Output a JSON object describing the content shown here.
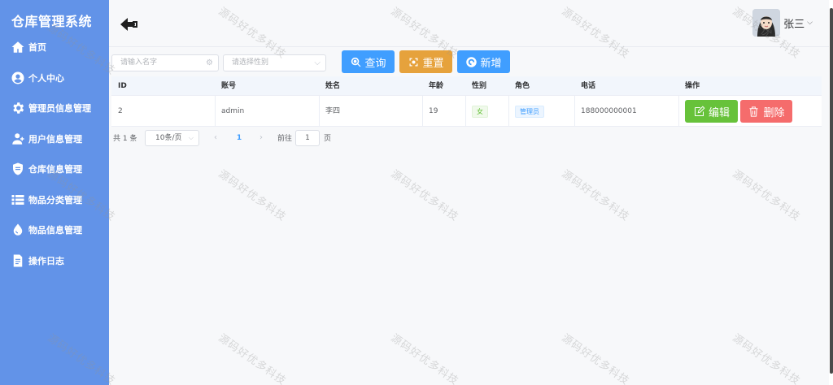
{
  "app": {
    "title": "仓库管理系统"
  },
  "sidebar": {
    "items": [
      {
        "label": "首页",
        "icon": "home-icon"
      },
      {
        "label": "个人中心",
        "icon": "user-center-icon"
      },
      {
        "label": "管理员信息管理",
        "icon": "gear-icon"
      },
      {
        "label": "用户信息管理",
        "icon": "user-add-icon"
      },
      {
        "label": "仓库信息管理",
        "icon": "shield-icon"
      },
      {
        "label": "物品分类管理",
        "icon": "list-icon"
      },
      {
        "label": "物品信息管理",
        "icon": "drop-icon"
      },
      {
        "label": "操作日志",
        "icon": "document-icon"
      }
    ]
  },
  "header": {
    "user_name": "张三",
    "caret": "⌵"
  },
  "search": {
    "name_placeholder": "请输入名字",
    "gender_placeholder": "请选择性别",
    "query_label": "查询",
    "reset_label": "重置",
    "add_label": "新增"
  },
  "table": {
    "headers": [
      "ID",
      "账号",
      "姓名",
      "年龄",
      "性别",
      "角色",
      "电话",
      "操作"
    ],
    "rows": [
      {
        "id": "2",
        "account": "admin",
        "name": "李四",
        "age": "19",
        "gender": "女",
        "role": "管理员",
        "phone": "188000000001"
      }
    ],
    "edit_label": "编辑",
    "delete_label": "删除"
  },
  "pagination": {
    "total_text": "共 1 条",
    "page_size": "10条/页",
    "current_page": "1",
    "jump_label": "前往",
    "jump_value": "1",
    "jump_unit": "页"
  },
  "watermark": "源码好优多科技",
  "colors": {
    "sidebar": "#6293e8",
    "primary": "#409eff",
    "warning": "#e6a23c",
    "success": "#67c23a",
    "danger": "#f56c6c"
  }
}
